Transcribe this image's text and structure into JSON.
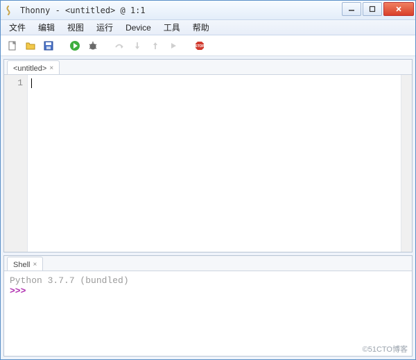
{
  "titlebar": {
    "title": "Thonny - <untitled> @ 1:1"
  },
  "menubar": {
    "items": [
      "文件",
      "编辑",
      "视图",
      "运行",
      "Device",
      "工具",
      "帮助"
    ]
  },
  "toolbar": {
    "icons": {
      "new": "new-file-icon",
      "open": "open-folder-icon",
      "save": "save-icon",
      "run": "run-icon",
      "debug": "debug-icon",
      "stepover": "step-over-icon",
      "stepinto": "step-into-icon",
      "stepout": "step-out-icon",
      "resume": "resume-icon",
      "stop": "stop-icon"
    }
  },
  "editor": {
    "tab_label": "<untitled>",
    "line_numbers": [
      "1"
    ],
    "content": ""
  },
  "shell": {
    "tab_label": "Shell",
    "banner": "Python 3.7.7 (bundled)",
    "prompt": ">>>"
  },
  "watermark": "©51CTO博客"
}
